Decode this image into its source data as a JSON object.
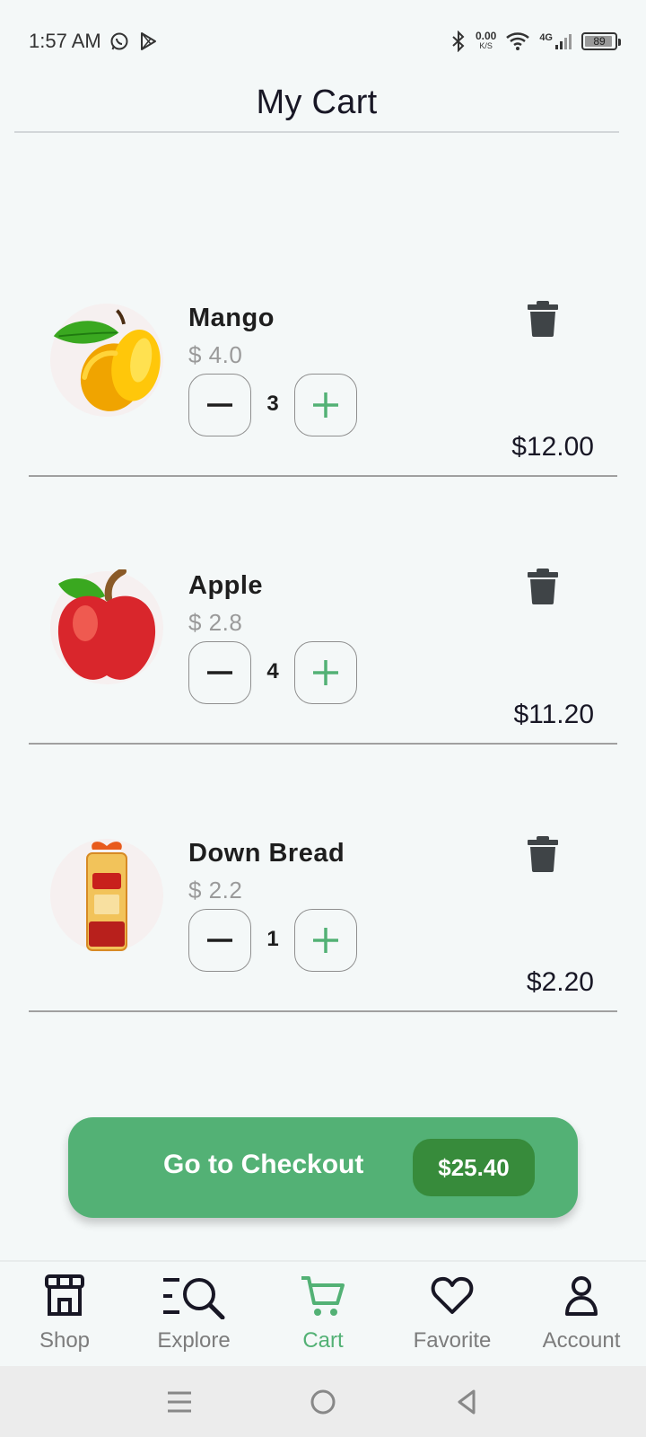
{
  "status_bar": {
    "time": "1:57 AM",
    "net_speed_value": "0.00",
    "net_speed_unit": "K/S",
    "signal": "4G",
    "battery": "89"
  },
  "header": {
    "title": "My Cart"
  },
  "cart_items": [
    {
      "name": "Mango",
      "unit_price": "$ 4.0",
      "quantity": "3",
      "total": "$12.00",
      "image": "mango-image"
    },
    {
      "name": "Apple",
      "unit_price": "$ 2.8",
      "quantity": "4",
      "total": "$11.20",
      "image": "apple-image"
    },
    {
      "name": "Down Bread",
      "unit_price": "$ 2.2",
      "quantity": "1",
      "total": "$2.20",
      "image": "bread-image"
    }
  ],
  "checkout": {
    "label": "Go to Checkout",
    "total": "$25.40"
  },
  "bottom_nav": {
    "active": "Cart",
    "items": [
      {
        "label": "Shop",
        "icon": "store-icon"
      },
      {
        "label": "Explore",
        "icon": "explore-icon"
      },
      {
        "label": "Cart",
        "icon": "cart-icon"
      },
      {
        "label": "Favorite",
        "icon": "heart-icon"
      },
      {
        "label": "Account",
        "icon": "account-icon"
      }
    ]
  },
  "colors": {
    "accent": "#53b175",
    "accent_dark": "#378b3b",
    "background": "#f4f8f8",
    "text": "#181725",
    "muted": "#7c7c7c"
  }
}
